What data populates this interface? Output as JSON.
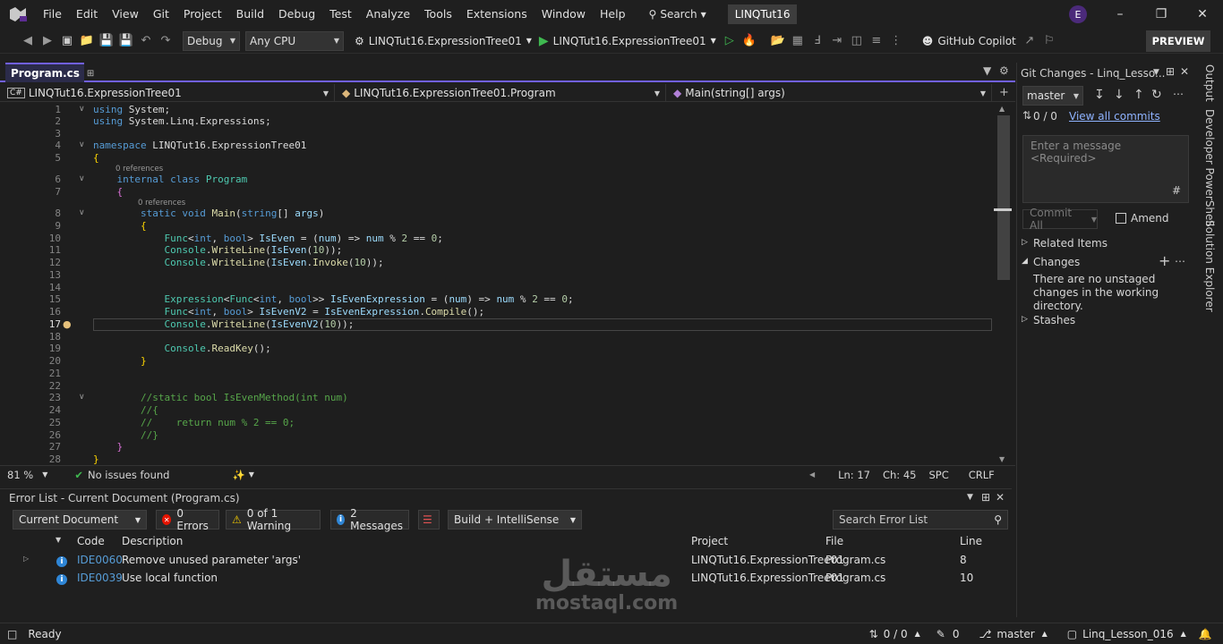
{
  "menubar": {
    "items": [
      "File",
      "Edit",
      "View",
      "Git",
      "Project",
      "Build",
      "Debug",
      "Test",
      "Analyze",
      "Tools",
      "Extensions",
      "Window",
      "Help"
    ],
    "search": "Search",
    "solution": "LINQTut16",
    "avatar": "E"
  },
  "toolbar": {
    "config": "Debug",
    "platform": "Any CPU",
    "startup_project": "LINQTut16.ExpressionTree01",
    "run_target": "LINQTut16.ExpressionTree01",
    "copilot": "GitHub Copilot",
    "preview": "PREVIEW"
  },
  "tab": {
    "name": "Program.cs"
  },
  "nav": {
    "project": "LINQTut16.ExpressionTree01",
    "type": "LINQTut16.ExpressionTree01.Program",
    "member": "Main(string[] args)"
  },
  "editor": {
    "line_numbers": [
      "1",
      "2",
      "3",
      "4",
      "5",
      "6",
      "7",
      "8",
      "9",
      "10",
      "11",
      "12",
      "13",
      "14",
      "15",
      "16",
      "17",
      "18",
      "19",
      "20",
      "21",
      "22",
      "23",
      "24",
      "25",
      "26",
      "27",
      "28"
    ],
    "refs": "0 references",
    "zoom": "81 %",
    "issues": "No issues found",
    "ln": "Ln: 17",
    "ch": "Ch: 45",
    "spc": "SPC",
    "crlf": "CRLF"
  },
  "error_list": {
    "title": "Error List - Current Document (Program.cs)",
    "scope": "Current Document",
    "errors": "0 Errors",
    "warnings": "0 of 1 Warning",
    "messages": "2 Messages",
    "build": "Build + IntelliSense",
    "search": "Search Error List",
    "columns": {
      "code": "Code",
      "desc": "Description",
      "project": "Project",
      "file": "File",
      "line": "Line"
    },
    "rows": [
      {
        "code": "IDE0060",
        "desc": "Remove unused parameter 'args'",
        "project": "LINQTut16.ExpressionTree01",
        "file": "Program.cs",
        "line": "8"
      },
      {
        "code": "IDE0039",
        "desc": "Use local function",
        "project": "LINQTut16.ExpressionTree01",
        "file": "Program.cs",
        "line": "10"
      }
    ]
  },
  "git": {
    "title": "Git Changes - Linq_Lesso...",
    "branch": "master",
    "sync": "0 / 0",
    "view_commits": "View all commits",
    "message_placeholder": "Enter a message <Required>",
    "commit_all": "Commit All",
    "amend": "Amend",
    "related": "Related Items",
    "changes": "Changes",
    "no_changes": "There are no unstaged changes in the working directory.",
    "stashes": "Stashes"
  },
  "side_tabs": [
    "Output",
    "Developer PowerShell",
    "Solution Explorer"
  ],
  "status": {
    "ready": "Ready",
    "sync": "0 / 0",
    "pencil": "0",
    "branch": "master",
    "repo": "Linq_Lesson_016"
  },
  "watermark": {
    "arabic": "مستقل",
    "latin": "mostaql.com"
  }
}
